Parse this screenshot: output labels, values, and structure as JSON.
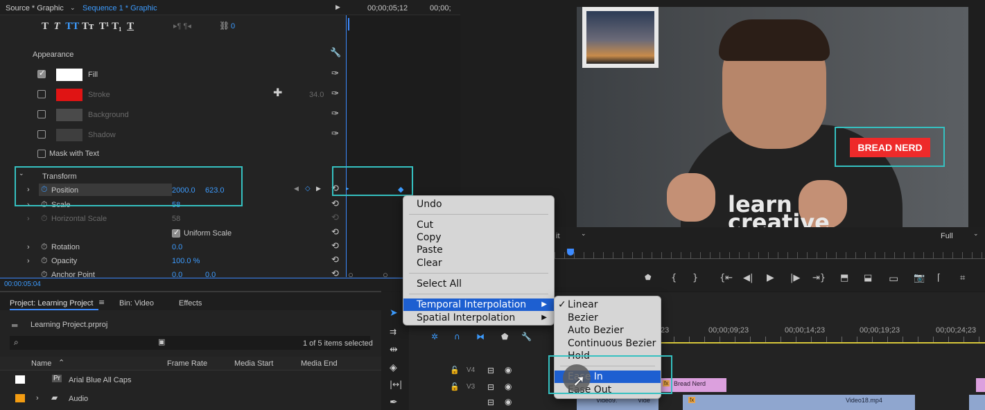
{
  "effect_controls": {
    "tab_source": "Source * Graphic",
    "tab_sequence": "Sequence 1 * Graphic",
    "timecode_end": "00;00;05;12",
    "timecode_end2": "00;00;",
    "tracking_value": "0",
    "appearance_label": "Appearance",
    "fill_label": "Fill",
    "stroke_label": "Stroke",
    "stroke_width": "34.0",
    "background_label": "Background",
    "shadow_label": "Shadow",
    "mask_label": "Mask with Text",
    "transform_label": "Transform",
    "position_label": "Position",
    "position_x": "2000.0",
    "position_y": "623.0",
    "scale_label": "Scale",
    "scale_value": "58",
    "hscale_label": "Horizontal Scale",
    "hscale_value": "58",
    "uniform_label": "Uniform Scale",
    "rotation_label": "Rotation",
    "rotation_value": "0.0",
    "opacity_label": "Opacity",
    "opacity_value": "100.0 %",
    "anchor_label": "Anchor Point",
    "anchor_x": "0.0",
    "anchor_y": "0.0",
    "current_time": "00:00:05:04",
    "colors": {
      "fill": "#ffffff",
      "stroke": "#e01414",
      "accent": "#3d9cff",
      "highlight": "#35c1c1"
    }
  },
  "program_monitor": {
    "badge_text": "BREAD NERD",
    "shirt_logo_line1": "learn",
    "shirt_logo_line2": "creative",
    "fit_label": "it",
    "quality_label": "Full"
  },
  "project": {
    "tab_project": "Project: Learning Project",
    "tab_bin": "Bin: Video",
    "tab_effects": "Effects",
    "project_file": "Learning Project.prproj",
    "selection_status": "1 of 5 items selected",
    "columns": [
      "Name",
      "Frame Rate",
      "Media Start",
      "Media End"
    ],
    "items": [
      {
        "name": "Arial Blue All Caps",
        "icon": "graphic-icon",
        "color": "#ffffff"
      },
      {
        "name": "Audio",
        "icon": "folder-icon",
        "color": "#f39c12"
      }
    ]
  },
  "timeline": {
    "timecodes": [
      "23",
      "00;00;09;23",
      "00;00;14;23",
      "00;00;19;23",
      "00;00;24;23"
    ],
    "tracks": [
      "V4",
      "V3"
    ],
    "clip_bread": "Bread Nerd",
    "clip_video18": "Video18.mp4",
    "clip_video9": "Video9.",
    "clip_vide": "Vide"
  },
  "context_menu": {
    "items": [
      {
        "label": "Undo"
      },
      {
        "label": "Cut"
      },
      {
        "label": "Copy"
      },
      {
        "label": "Paste"
      },
      {
        "label": "Clear"
      },
      {
        "label": "Select All"
      },
      {
        "label": "Temporal Interpolation",
        "highlighted": true,
        "has_submenu": true
      },
      {
        "label": "Spatial Interpolation",
        "has_submenu": true
      }
    ]
  },
  "submenu": {
    "items": [
      {
        "label": "Linear",
        "checked": true
      },
      {
        "label": "Bezier"
      },
      {
        "label": "Auto Bezier"
      },
      {
        "label": "Continuous Bezier"
      },
      {
        "label": "Hold"
      },
      {
        "label": "Ease In",
        "highlighted": true
      },
      {
        "label": "Ease Out"
      }
    ],
    "checkmark": "✓"
  }
}
